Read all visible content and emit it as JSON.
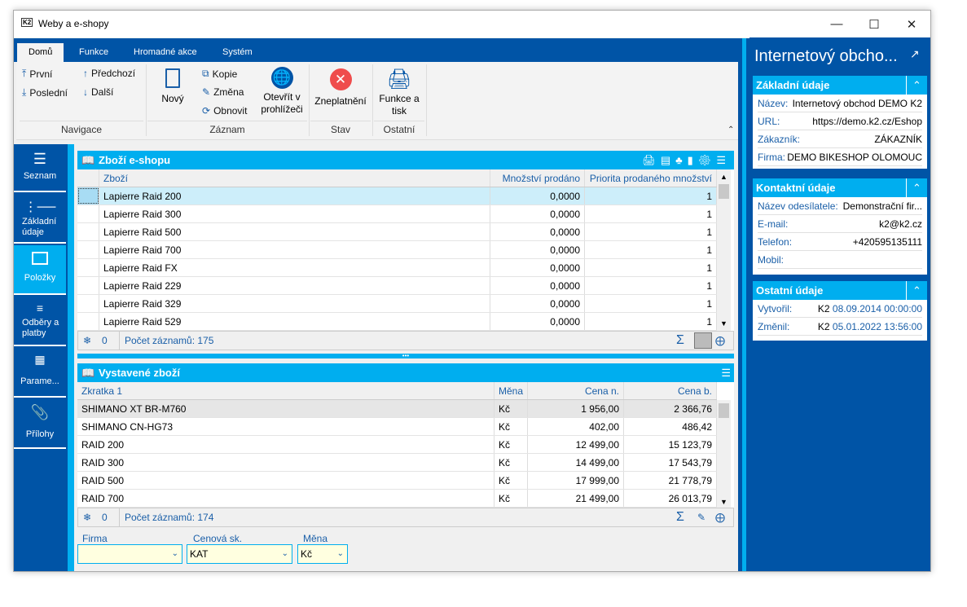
{
  "window": {
    "title": "Weby a e-shopy",
    "app_icon": "K2"
  },
  "ribbon": {
    "tabs": [
      "Domů",
      "Funkce",
      "Hromadné akce",
      "Systém"
    ],
    "navigace": {
      "first": "První",
      "last": "Poslední",
      "prev": "Předchozí",
      "next": "Další",
      "group": "Navigace"
    },
    "zaznam": {
      "new": "Nový",
      "copy": "Kopie",
      "edit": "Změna",
      "refresh": "Obnovit",
      "open": "Otevřít v prohlížeči",
      "group": "Záznam"
    },
    "stav": {
      "invalidate": "Zneplatnění",
      "group": "Stav"
    },
    "ostatni": {
      "print": "Funkce a tisk",
      "group": "Ostatní"
    }
  },
  "sidebar": {
    "items": [
      {
        "label": "Seznam"
      },
      {
        "label": "Základní údaje"
      },
      {
        "label": "Položky"
      },
      {
        "label": "Odběry a platby"
      },
      {
        "label": "Parame..."
      },
      {
        "label": "Přílohy"
      }
    ]
  },
  "products": {
    "title": "Zboží e-shopu",
    "columns": [
      "Zboží",
      "Množství prodáno",
      "Priorita prodaného množství"
    ],
    "rows": [
      [
        "Lapierre Raid 200",
        "0,0000",
        "1"
      ],
      [
        "Lapierre Raid 300",
        "0,0000",
        "1"
      ],
      [
        "Lapierre Raid 500",
        "0,0000",
        "1"
      ],
      [
        "Lapierre Raid 700",
        "0,0000",
        "1"
      ],
      [
        "Lapierre Raid FX",
        "0,0000",
        "1"
      ],
      [
        "Lapierre Raid 229",
        "0,0000",
        "1"
      ],
      [
        "Lapierre Raid 329",
        "0,0000",
        "1"
      ],
      [
        "Lapierre Raid 529",
        "0,0000",
        "1"
      ]
    ],
    "selected_count": "0",
    "record_count": "Počet záznamů: 175"
  },
  "listed": {
    "title": "Vystavené zboží",
    "columns": [
      "Zkratka 1",
      "Měna",
      "Cena n.",
      "Cena b."
    ],
    "rows": [
      [
        "SHIMANO XT BR-M760",
        "Kč",
        "1 956,00",
        "2 366,76"
      ],
      [
        "SHIMANO CN-HG73",
        "Kč",
        "402,00",
        "486,42"
      ],
      [
        "RAID 200",
        "Kč",
        "12 499,00",
        "15 123,79"
      ],
      [
        "RAID 300",
        "Kč",
        "14 499,00",
        "17 543,79"
      ],
      [
        "RAID 500",
        "Kč",
        "17 999,00",
        "21 778,79"
      ],
      [
        "RAID 700",
        "Kč",
        "21 499,00",
        "26 013,79"
      ]
    ],
    "selected_count": "0",
    "record_count": "Počet záznamů: 174"
  },
  "filters": {
    "firma": {
      "label": "Firma",
      "value": ""
    },
    "cenova": {
      "label": "Cenová sk.",
      "value": "KAT"
    },
    "mena": {
      "label": "Měna",
      "value": "Kč"
    }
  },
  "right": {
    "title": "Internetový obcho...",
    "basic": {
      "title": "Základní údaje",
      "items": [
        {
          "k": "Název:",
          "v": "Internetový obchod DEMO K2"
        },
        {
          "k": "URL:",
          "v": "https://demo.k2.cz/Eshop"
        },
        {
          "k": "Zákazník:",
          "v": "ZÁKAZNÍK"
        },
        {
          "k": "Firma:",
          "v": "DEMO BIKESHOP OLOMOUC"
        }
      ]
    },
    "contact": {
      "title": "Kontaktní údaje",
      "items": [
        {
          "k": "Název odesílatele:",
          "v": "Demonstrační fir..."
        },
        {
          "k": "E-mail:",
          "v": "k2@k2.cz"
        },
        {
          "k": "Telefon:",
          "v": "+420595135111"
        },
        {
          "k": "Mobil:",
          "v": ""
        }
      ]
    },
    "other": {
      "title": "Ostatní údaje",
      "items": [
        {
          "k": "Vytvořil:",
          "u": "K2",
          "v": "08.09.2014 00:00:00"
        },
        {
          "k": "Změnil:",
          "u": "K2",
          "v": "05.01.2022 13:56:00"
        }
      ]
    }
  },
  "colors": {
    "dark_blue": "#0054a6",
    "light_blue": "#00aeef",
    "selected_row": "#cdeefa"
  }
}
